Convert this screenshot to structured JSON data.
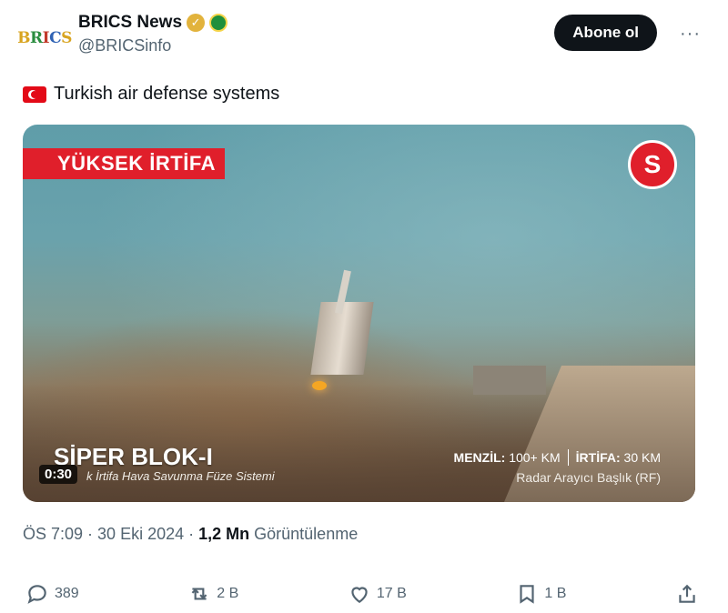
{
  "header": {
    "avatar_text": "BRICS",
    "display_name": "BRICS News",
    "handle": "@BRICSinfo",
    "follow_label": "Abone ol",
    "more_label": "···"
  },
  "tweet": {
    "flag_icon": "turkey-flag-icon",
    "text": "Turkish air defense systems"
  },
  "media": {
    "label_top": "YÜKSEK İRTİFA",
    "brand_logo": "S",
    "title": "SİPER BLOK-I",
    "subtitle": "k İrtifa Hava Savunma Füze Sistemi",
    "spec_range_label": "MENZİL:",
    "spec_range_value": "100+ KM",
    "spec_alt_label": "İRTİFA:",
    "spec_alt_value": "30 KM",
    "spec_sub": "Radar Arayıcı Başlık (RF)",
    "duration": "0:30"
  },
  "meta": {
    "time": "ÖS 7:09",
    "sep1": "·",
    "date": "30 Eki 2024",
    "sep2": "·",
    "views_count": "1,2 Mn",
    "views_label": "Görüntülenme"
  },
  "actions": {
    "replies": "389",
    "reposts": "2 B",
    "likes": "17 B",
    "bookmarks": "1 B"
  },
  "colors": {
    "follow_bg": "#0f1419",
    "label_red": "#e01f2b",
    "muted": "#536471"
  }
}
